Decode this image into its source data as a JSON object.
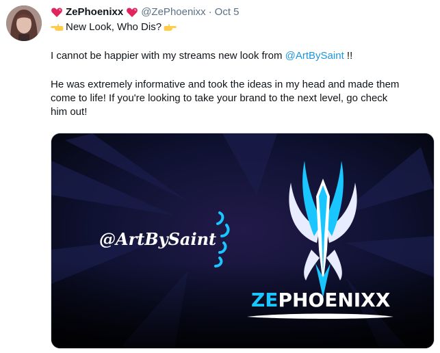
{
  "tweet": {
    "display_name": "ZePhoenixx",
    "handle": "@ZePhoenixx",
    "separator": "·",
    "date": "Oct 5",
    "subtitle": "New Look, Who Dis?",
    "para1_prefix": "I cannot be happier with my streams new look from ",
    "para1_mention": "@ArtBySaint",
    "para1_suffix": " !!",
    "para2_line1": "He was extremely informative and took the ideas in my head and made them",
    "para2_line2": "come to life! If you're looking to take your brand to the next level, go check",
    "para2_line3": "him out!"
  },
  "media": {
    "artist_tag": "@ArtBySaint",
    "logo_text_ze": "ZE",
    "logo_text_rest": "PHOENIXX",
    "accent_color": "#19c6ff",
    "background_color": "#0a0d24"
  },
  "icons": {
    "heart": "sparkling-heart-icon",
    "hand_left": "backhand-index-pointing-left-icon",
    "hand_right": "backhand-index-pointing-left-icon"
  }
}
